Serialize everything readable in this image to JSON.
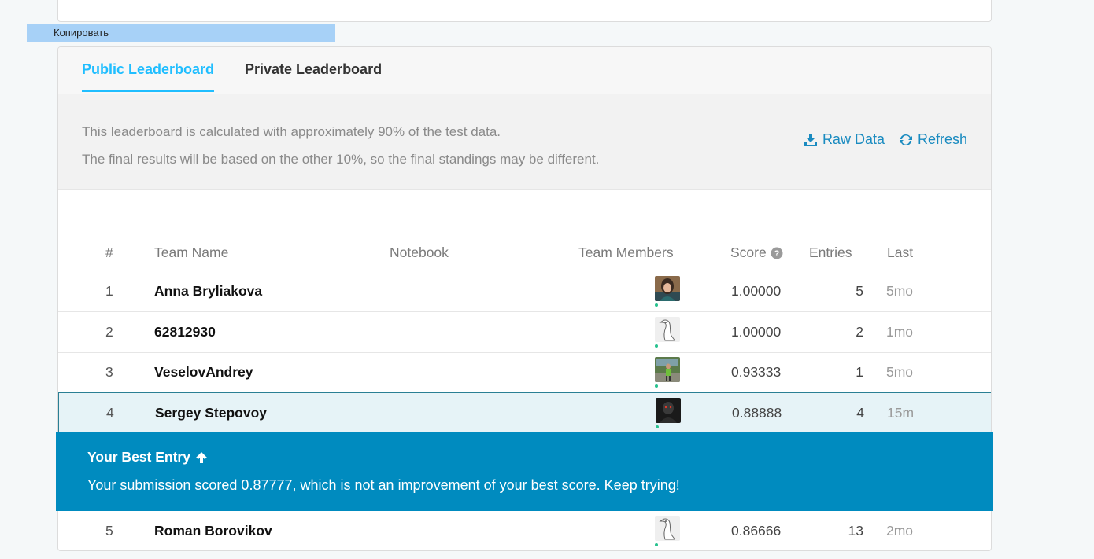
{
  "copy_bar": {
    "label": "Копировать"
  },
  "tabs": [
    {
      "label": "Public Leaderboard",
      "active": true
    },
    {
      "label": "Private Leaderboard",
      "active": false
    }
  ],
  "info": {
    "line1": "This leaderboard is calculated with approximately 90% of the test data.",
    "line2": "The final results will be based on the other 10%, so the final standings may be different."
  },
  "actions": {
    "raw_data": "Raw Data",
    "refresh": "Refresh"
  },
  "columns": {
    "rank": "#",
    "team": "Team Name",
    "notebook": "Notebook",
    "members": "Team Members",
    "score": "Score",
    "entries": "Entries",
    "last": "Last"
  },
  "rows": [
    {
      "rank": "1",
      "team": "Anna Bryliakova",
      "score": "1.00000",
      "entries": "5",
      "last": "5mo",
      "avatar": "person-photo"
    },
    {
      "rank": "2",
      "team": "62812930",
      "score": "1.00000",
      "entries": "2",
      "last": "1mo",
      "avatar": "goose-default"
    },
    {
      "rank": "3",
      "team": "VeselovAndrey",
      "score": "0.93333",
      "entries": "1",
      "last": "5mo",
      "avatar": "outdoor-photo"
    },
    {
      "rank": "4",
      "team": "Sergey Stepovoy",
      "score": "0.88888",
      "entries": "4",
      "last": "15m",
      "avatar": "dark-figure"
    },
    {
      "rank": "5",
      "team": "Roman Borovikov",
      "score": "0.86666",
      "entries": "13",
      "last": "2mo",
      "avatar": "goose-default"
    }
  ],
  "best_entry": {
    "title": "Your Best Entry",
    "message": "Your submission scored 0.87777, which is not an improvement of your best score. Keep trying!"
  },
  "colors": {
    "accent": "#20beff",
    "link": "#1a8bc0",
    "banner": "#008bbf",
    "highlight_row": "#e6f3f7",
    "online_dot": "#28c28f"
  }
}
